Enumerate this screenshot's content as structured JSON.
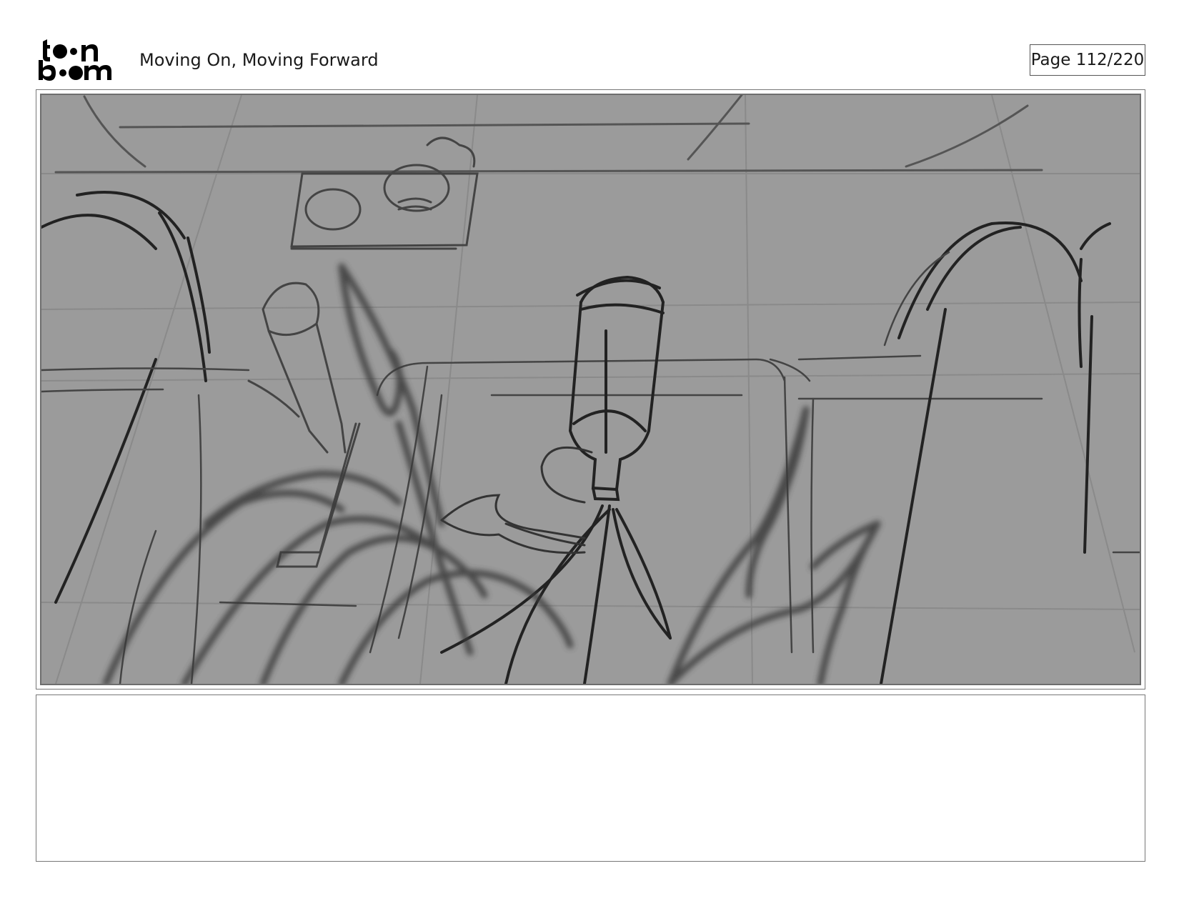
{
  "header": {
    "logo_alt": "toon boom",
    "title": "Moving On, Moving Forward",
    "page_label": "Page 112/220"
  },
  "panel": {
    "description": "",
    "notes": ""
  },
  "colors": {
    "panel_background": "#9b9b9b",
    "sketch_dark": "#2a2a2a",
    "sketch_light": "#6a6a6a",
    "frame_border": "#777777"
  }
}
